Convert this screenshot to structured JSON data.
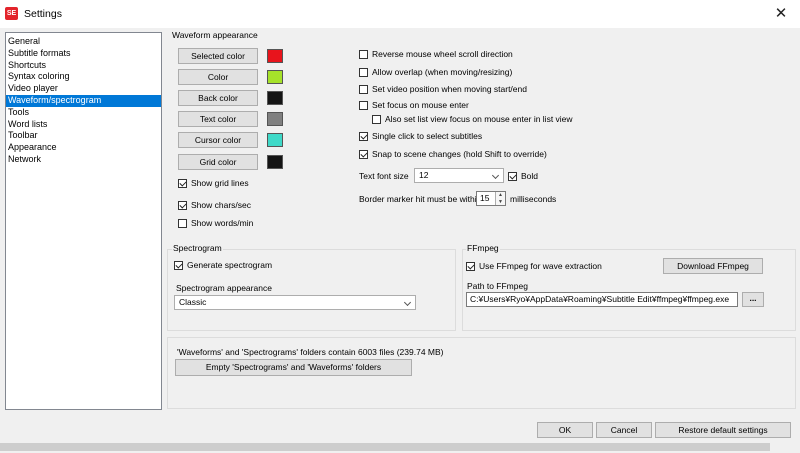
{
  "window": {
    "title": "Settings",
    "icon_text": "SE",
    "close_glyph": "✕"
  },
  "sidebar": {
    "items": [
      {
        "label": "General"
      },
      {
        "label": "Subtitle formats"
      },
      {
        "label": "Shortcuts"
      },
      {
        "label": "Syntax coloring"
      },
      {
        "label": "Video player"
      },
      {
        "label": "Waveform/spectrogram",
        "selected": true
      },
      {
        "label": "Tools"
      },
      {
        "label": "Word lists"
      },
      {
        "label": "Toolbar"
      },
      {
        "label": "Appearance"
      },
      {
        "label": "Network"
      }
    ]
  },
  "waveform": {
    "group_title": "Waveform appearance",
    "color_buttons": [
      {
        "label": "Selected color",
        "color": "#e8141c"
      },
      {
        "label": "Color",
        "color": "#a6e22a"
      },
      {
        "label": "Back color",
        "color": "#141414"
      },
      {
        "label": "Text color",
        "color": "#808080"
      },
      {
        "label": "Cursor color",
        "color": "#3fd9c8"
      },
      {
        "label": "Grid color",
        "color": "#141414"
      }
    ],
    "show_grid_lines": {
      "label": "Show grid lines",
      "checked": true
    },
    "show_chars_sec": {
      "label": "Show chars/sec",
      "checked": true
    },
    "show_words_min": {
      "label": "Show words/min",
      "checked": false
    },
    "options": {
      "reverse_scroll": {
        "label": "Reverse mouse wheel scroll direction",
        "checked": false
      },
      "allow_overlap": {
        "label": "Allow overlap (when moving/resizing)",
        "checked": false
      },
      "set_video_pos": {
        "label": "Set video position when moving start/end",
        "checked": false
      },
      "focus_mouse_enter": {
        "label": "Set focus on mouse enter",
        "checked": false
      },
      "focus_list_view": {
        "label": "Also set list view focus on mouse enter in list view",
        "checked": false
      },
      "single_click": {
        "label": "Single click to select subtitles",
        "checked": true
      },
      "snap_scene": {
        "label": "Snap to scene changes (hold Shift to override)",
        "checked": true
      }
    },
    "text_font_size_label": "Text font size",
    "text_font_size_value": "12",
    "bold": {
      "label": "Bold",
      "checked": true
    },
    "border_marker_label": "Border marker hit must be within",
    "border_marker_value": "15",
    "border_marker_unit": "milliseconds"
  },
  "spectrogram": {
    "group_title": "Spectrogram",
    "generate": {
      "label": "Generate spectrogram",
      "checked": true
    },
    "appearance_label": "Spectrogram appearance",
    "appearance_value": "Classic"
  },
  "ffmpeg": {
    "group_title": "FFmpeg",
    "use": {
      "label": "Use FFmpeg for wave extraction",
      "checked": true
    },
    "download_label": "Download FFmpeg",
    "path_label": "Path to FFmpeg",
    "path_value": "C:¥Users¥Ryo¥AppData¥Roaming¥Subtitle Edit¥ffmpeg¥ffmpeg.exe",
    "browse_label": "..."
  },
  "folders": {
    "info": "'Waveforms' and 'Spectrograms' folders contain 6003 files (239.74 MB)",
    "empty_label": "Empty 'Spectrograms' and 'Waveforms' folders"
  },
  "footer": {
    "ok_label": "OK",
    "cancel_label": "Cancel",
    "restore_label": "Restore default settings"
  }
}
